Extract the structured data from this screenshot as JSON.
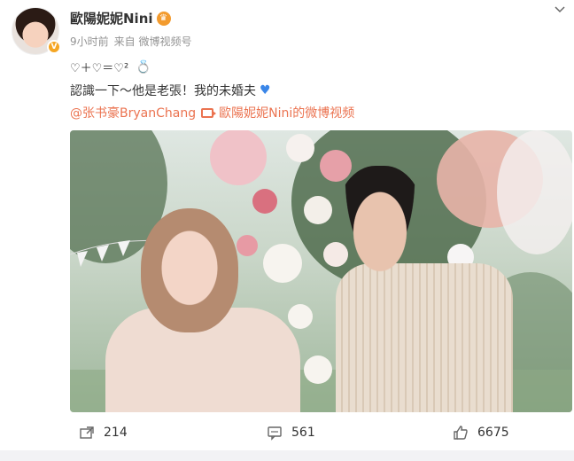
{
  "post": {
    "username": "歐陽妮妮Nini",
    "time": "9小时前",
    "source": "来自 微博视频号",
    "line1": "♡＋♡＝♡²",
    "line2": "認識一下～他是老張！我的未婚夫",
    "mention": "@张书豪BryanChang",
    "video_link": "歐陽妮妮Nini的微博视频"
  },
  "icons": {
    "verified": "verified-badge",
    "crown": "crown-icon",
    "ring": "ring-icon",
    "heart": "blue-heart-icon",
    "video": "video-link-icon",
    "chevron": "chevron-down-icon",
    "repost": "repost-icon",
    "comment": "comment-icon",
    "like": "like-icon"
  },
  "stats": {
    "repost": "214",
    "comment": "561",
    "like": "6675"
  },
  "colors": {
    "link": "#eb7350",
    "heart": "#3a86e8",
    "badge": "#f5a623",
    "meta": "#939393"
  }
}
